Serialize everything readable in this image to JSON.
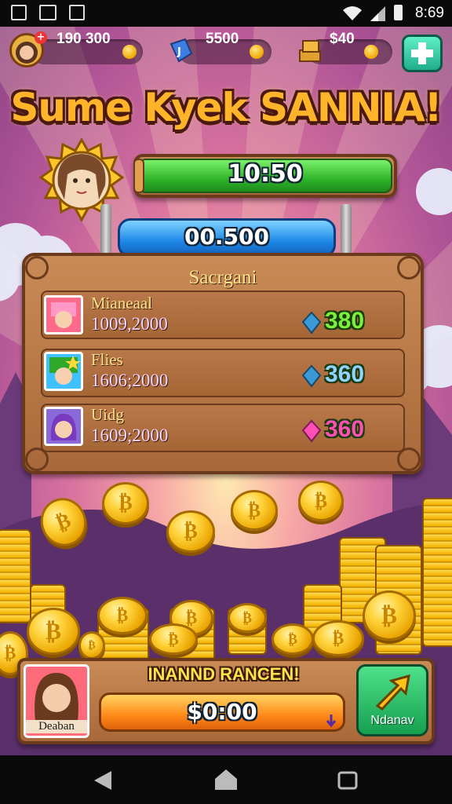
{
  "status_bar": {
    "time": "8:69"
  },
  "resources": {
    "coins": "190 300",
    "gems": "5500",
    "cash": "$40"
  },
  "title": "Sume Kyek SANNIA!",
  "timer_bar": {
    "value": "10:50"
  },
  "score_bar": {
    "value": "00.500"
  },
  "leaderboard": {
    "header": "Sacrgani",
    "rows": [
      {
        "name": "Mianeaal",
        "score": "1009,2000",
        "value": "380",
        "value_color": "#7cf03a"
      },
      {
        "name": "Flies",
        "score": "1606;2000",
        "value": "360",
        "value_color": "#8fd3ff"
      },
      {
        "name": "Uidg",
        "score": "1609;2000",
        "value": "360",
        "value_color": "#ff4fb4"
      }
    ]
  },
  "bottom_panel": {
    "player_name": "Deaban",
    "banner": "INANND RANCEN!",
    "amount": "$0:00",
    "action_label": "Ndanav"
  }
}
